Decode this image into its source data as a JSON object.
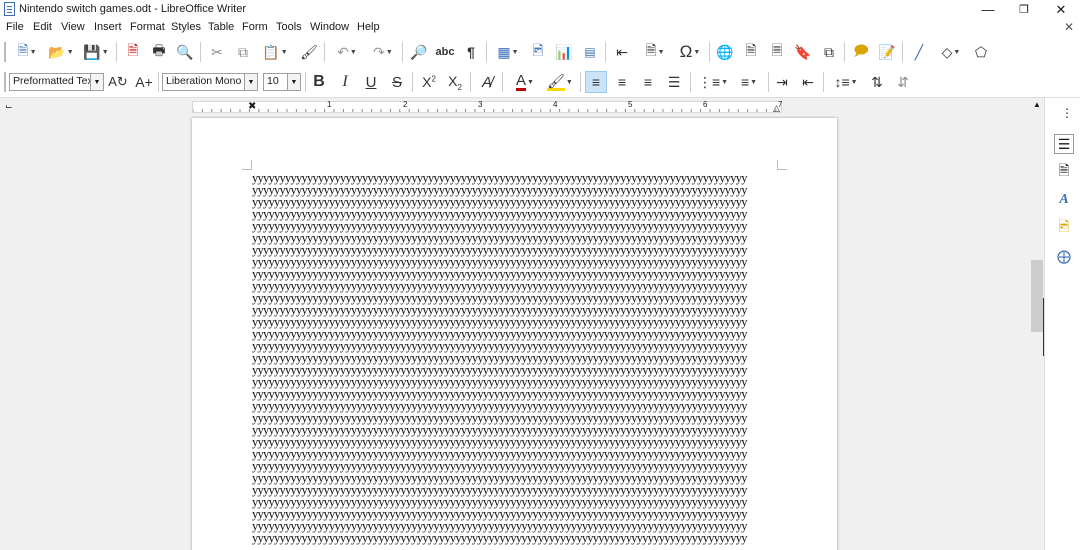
{
  "window": {
    "title": "Nintendo switch games.odt - LibreOffice Writer"
  },
  "menu": [
    "File",
    "Edit",
    "View",
    "Insert",
    "Format",
    "Styles",
    "Table",
    "Form",
    "Tools",
    "Window",
    "Help"
  ],
  "formatting": {
    "paragraph_style": "Preformatted Text",
    "font_name": "Liberation Mono",
    "font_size": "10"
  },
  "document": {
    "line_text": "yyyyyyyyyyyyyyyyyyyyyyyyyyyyyyyyyyyyyyyyyyyyyyyyyyyyyyyyyyyyyyyyyyyyyyyyyyyyyyyyyyyyyyyyyy",
    "visible_line_count": 31
  },
  "ruler": {
    "marks": [
      "1",
      "2",
      "3",
      "4",
      "5",
      "6",
      "7"
    ]
  },
  "icons": {
    "toolbar1": [
      "new-document-icon",
      "open-icon",
      "save-icon",
      "export-pdf-icon",
      "print-icon",
      "print-preview-icon",
      "cut-icon",
      "copy-icon",
      "paste-icon",
      "clone-formatting-icon",
      "undo-icon",
      "redo-icon",
      "find-replace-icon",
      "spelling-icon",
      "formatting-marks-icon",
      "insert-table-icon",
      "insert-image-icon",
      "insert-chart-icon",
      "insert-textbox-icon",
      "page-break-icon",
      "insert-field-icon",
      "special-character-icon",
      "hyperlink-icon",
      "footnote-icon",
      "endnote-icon",
      "bookmark-icon",
      "cross-reference-icon",
      "comment-icon",
      "track-changes-icon",
      "line-icon",
      "shapes-icon",
      "draw-functions-icon"
    ],
    "toolbar2": [
      "update-style-icon",
      "new-style-icon",
      "bold-icon",
      "italic-icon",
      "underline-icon",
      "strikethrough-icon",
      "superscript-icon",
      "subscript-icon",
      "clear-formatting-icon",
      "font-color-icon",
      "highlight-icon",
      "align-left-icon",
      "align-center-icon",
      "align-right-icon",
      "justify-icon",
      "unordered-list-icon",
      "ordered-list-icon",
      "increase-indent-icon",
      "decrease-indent-icon",
      "line-spacing-icon",
      "increase-paragraph-spacing-icon",
      "decrease-paragraph-spacing-icon"
    ],
    "sidebar": [
      "properties-icon",
      "page-icon",
      "styles-icon",
      "gallery-icon",
      "navigator-icon"
    ]
  },
  "colors": {
    "accent": "#3c6fb5",
    "font_color": "#c00000",
    "highlight": "#ffd700",
    "active_button": "#cce4f7"
  }
}
